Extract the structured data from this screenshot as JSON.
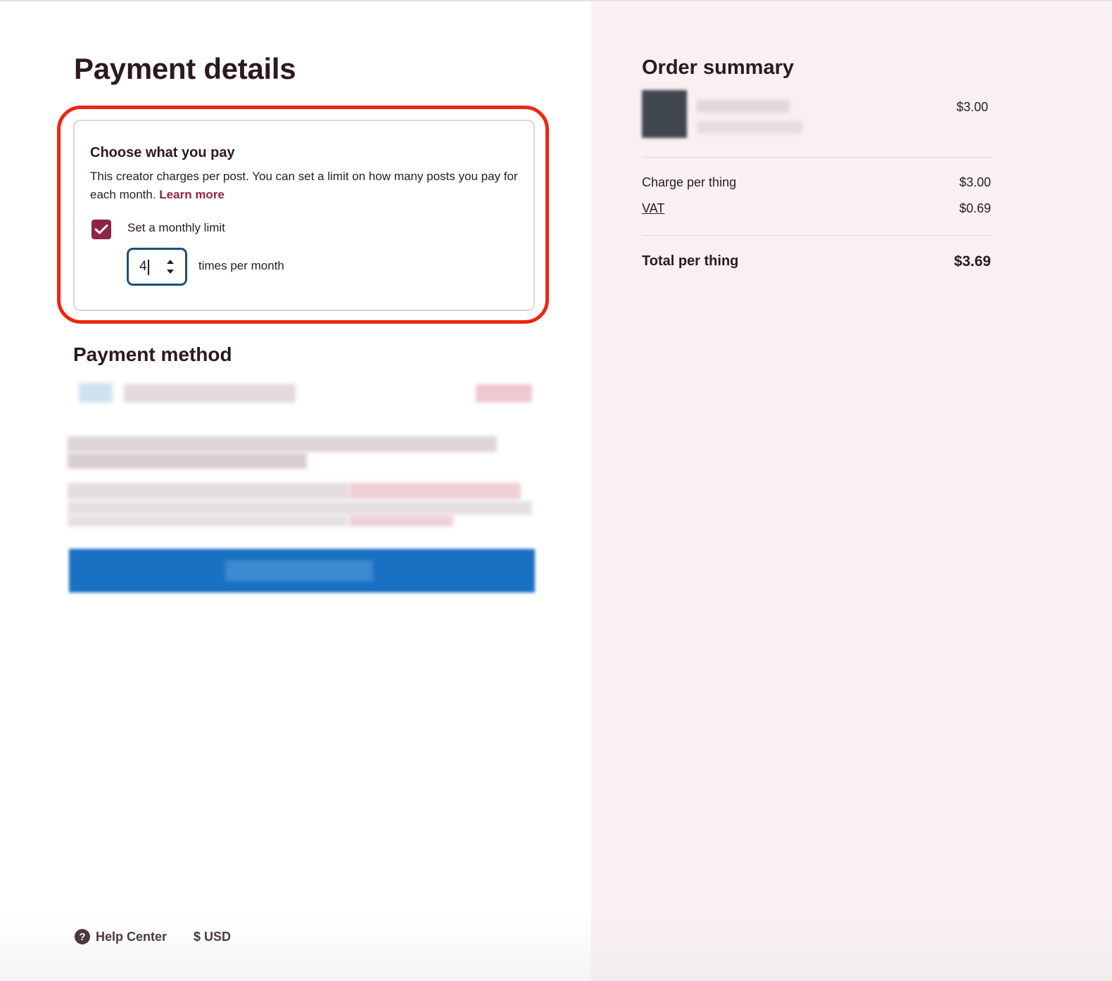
{
  "page": {
    "title": "Payment details"
  },
  "choose_what_you_pay": {
    "title": "Choose what you pay",
    "description": "This creator charges per post. You can set a limit on how many posts you pay for each month.",
    "learn_more": "Learn more",
    "monthly_limit_checkbox": {
      "label": "Set a monthly limit",
      "checked": true
    },
    "limit_input": {
      "value": "4",
      "unit": "times per month"
    }
  },
  "payment_method": {
    "title": "Payment method"
  },
  "footer": {
    "help": "Help Center",
    "currency": "$ USD"
  },
  "order_summary": {
    "title": "Order summary",
    "item_price": "$3.00",
    "lines": [
      {
        "label": "Charge per thing",
        "value": "$3.00"
      },
      {
        "label": "VAT",
        "value": "$0.69"
      }
    ],
    "total": {
      "label": "Total per thing",
      "value": "$3.69"
    }
  },
  "colors": {
    "accent": "#8e2447",
    "highlight": "#f0250f",
    "panel": "#faf0f1",
    "pay_button": "#0a68bf"
  }
}
